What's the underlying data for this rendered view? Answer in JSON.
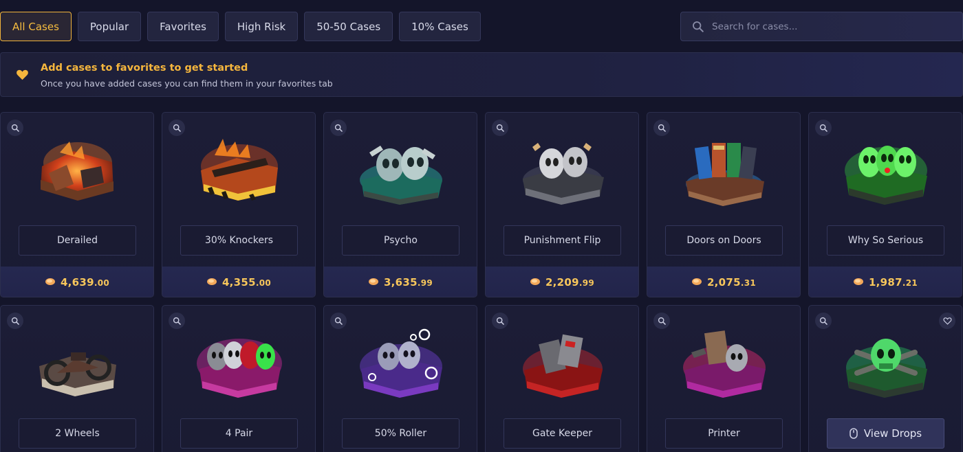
{
  "tabs": [
    {
      "label": "All Cases",
      "active": true
    },
    {
      "label": "Popular"
    },
    {
      "label": "Favorites"
    },
    {
      "label": "High Risk"
    },
    {
      "label": "50-50 Cases"
    },
    {
      "label": "10% Cases"
    }
  ],
  "search": {
    "placeholder": "Search for cases...",
    "value": ""
  },
  "banner": {
    "title": "Add cases to favorites to get started",
    "subtitle": "Once you have added cases you can find them in your favorites tab"
  },
  "colors": {
    "accent": "#f5b63d",
    "background": "#14152a",
    "card": "#1c1d36"
  },
  "cases_row1": [
    {
      "name": "Derailed",
      "price_main": "4,639",
      "price_cents": ".00",
      "icon": "fire-crate-icon"
    },
    {
      "name": "30% Knockers",
      "price_main": "4,355",
      "price_cents": ".00",
      "icon": "flame-gun-crate-icon"
    },
    {
      "name": "Psycho",
      "price_main": "3,635",
      "price_cents": ".99",
      "icon": "teal-mask-crate-icon"
    },
    {
      "name": "Punishment Flip",
      "price_main": "2,209",
      "price_cents": ".99",
      "icon": "silver-mask-crate-icon"
    },
    {
      "name": "Doors on Doors",
      "price_main": "2,075",
      "price_cents": ".31",
      "icon": "doors-crate-icon"
    },
    {
      "name": "Why So Serious",
      "price_main": "1,987",
      "price_cents": ".21",
      "icon": "green-mask-crate-icon"
    }
  ],
  "cases_row2": [
    {
      "name": "2 Wheels",
      "icon": "motorbike-crate-icon"
    },
    {
      "name": "4 Pair",
      "icon": "pink-mask-crate-icon"
    },
    {
      "name": "50% Roller",
      "icon": "purple-bubble-crate-icon"
    },
    {
      "name": "Gate Keeper",
      "icon": "red-cards-crate-icon"
    },
    {
      "name": "Printer",
      "icon": "pink-printer-crate-icon"
    },
    {
      "view_drops_label": "View Drops",
      "icon": "green-skull-crate-icon"
    }
  ]
}
